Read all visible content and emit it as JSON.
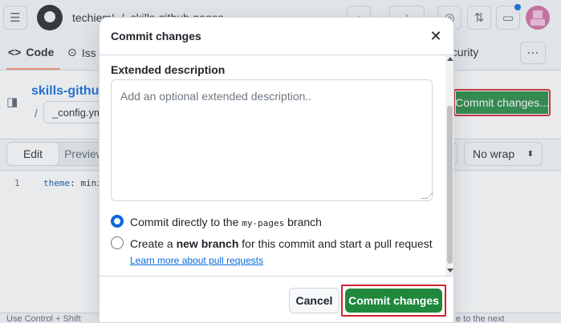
{
  "header": {
    "breadcrumb_owner": "techiemI",
    "breadcrumb_sep": "/",
    "breadcrumb_repo": "skills-github-pages"
  },
  "tabs": {
    "code": "Code",
    "issues": "Iss",
    "security": "ecurity"
  },
  "repo": {
    "name": "skills-github",
    "slash": "/",
    "filename": "_config.ym",
    "commit_top_label": "Commit changes..."
  },
  "editor": {
    "tab_edit": "Edit",
    "tab_preview": "Preview",
    "wrap_mode": "No wrap",
    "line_number": "1",
    "code_key": "theme",
    "code_rest": ": mini"
  },
  "bottom_hint": {
    "left": "Use Control + Shift",
    "right": "e to the next"
  },
  "modal": {
    "title": "Commit changes",
    "extended_label": "Extended description",
    "extended_placeholder": "Add an optional extended description..",
    "radio_direct_pre": "Commit directly to the ",
    "radio_direct_branch": "my-pages",
    "radio_direct_post": " branch",
    "radio_new_pre": "Create a ",
    "radio_new_bold": "new branch",
    "radio_new_post": " for this commit and start a pull request ",
    "learn_more": "Learn more about pull requests",
    "cancel_label": "Cancel",
    "commit_label": "Commit changes",
    "selected_option": "commit-directly"
  },
  "colors": {
    "primary_green": "#1f883d",
    "highlight_red": "#cf222e",
    "link_blue": "#0969da"
  }
}
